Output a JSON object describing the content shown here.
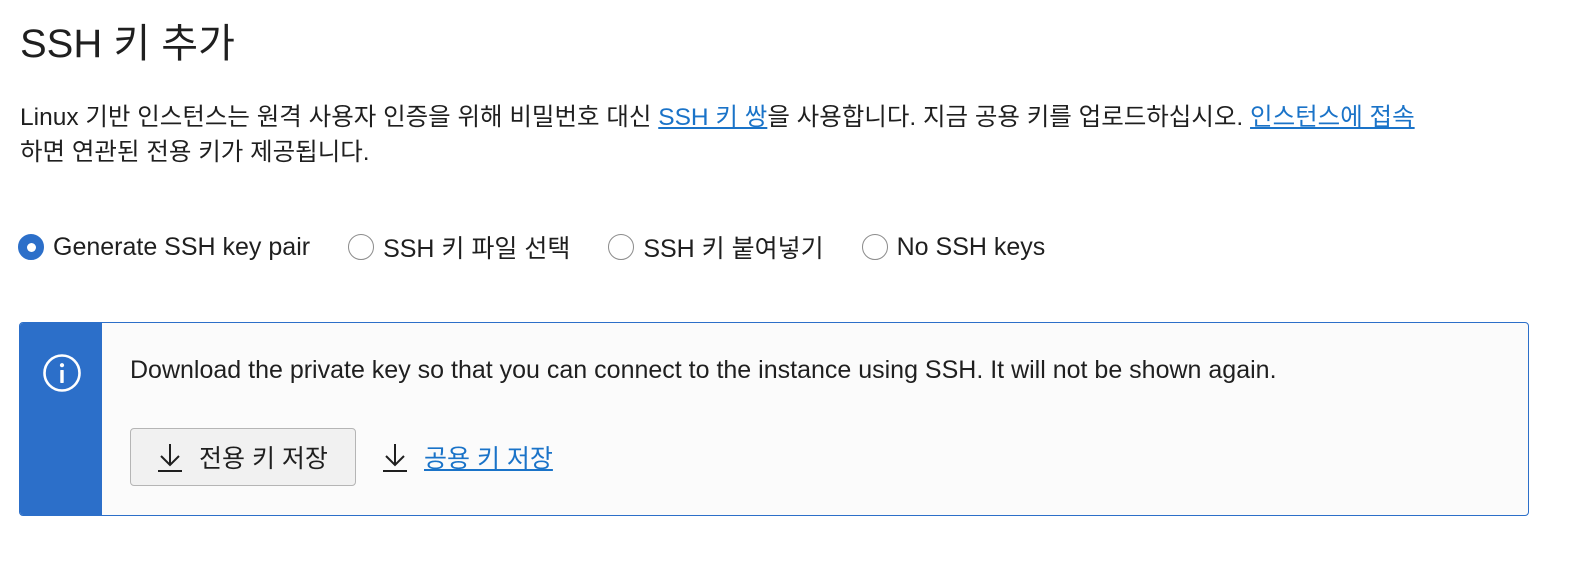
{
  "header": {
    "title": "SSH 키 추가"
  },
  "description": {
    "text_1": "Linux 기반 인스턴스는 원격 사용자 인증을 위해 비밀번호 대신 ",
    "link_1": "SSH 키 쌍",
    "text_2": "을 사용합니다. 지금 공용 키를 업로드하십시오. ",
    "link_2": "인스턴스에 접속",
    "text_3": "하면 연관된 전용 키가 제공됩니다."
  },
  "ssh_options": {
    "selected": "Generate SSH key pair",
    "options": [
      {
        "label": "Generate SSH key pair",
        "checked": true
      },
      {
        "label": "SSH 키 파일 선택",
        "checked": false
      },
      {
        "label": "SSH 키 붙여넣기",
        "checked": false
      },
      {
        "label": "No SSH keys",
        "checked": false
      }
    ]
  },
  "info_banner": {
    "icon": "info-icon",
    "message": "Download the private key so that you can connect to the instance using SSH. It will not be shown again.",
    "save_private_key_label": "전용 키 저장",
    "save_public_key_label": "공용 키 저장",
    "download_icon": "download-icon"
  },
  "colors": {
    "accent": "#2c6fc9",
    "link": "#1a73c8",
    "text": "#1f1f1f"
  }
}
